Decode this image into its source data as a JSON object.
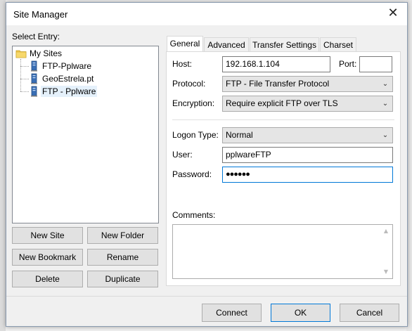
{
  "window": {
    "title": "Site Manager"
  },
  "tree": {
    "label": "Select Entry:",
    "root": "My Sites",
    "sites": [
      "FTP-Pplware",
      "GeoEstrela.pt",
      "FTP - Pplware"
    ],
    "selected_index": 2
  },
  "left_buttons": {
    "new_site": "New Site",
    "new_folder": "New Folder",
    "new_bookmark": "New Bookmark",
    "rename": "Rename",
    "delete": "Delete",
    "duplicate": "Duplicate"
  },
  "tabs": [
    "General",
    "Advanced",
    "Transfer Settings",
    "Charset"
  ],
  "active_tab": "General",
  "general": {
    "host_label": "Host:",
    "host_value": "192.168.1.104",
    "port_label": "Port:",
    "port_value": "",
    "protocol_label": "Protocol:",
    "protocol_value": "FTP - File Transfer Protocol",
    "encryption_label": "Encryption:",
    "encryption_value": "Require explicit FTP over TLS",
    "logon_label": "Logon Type:",
    "logon_value": "Normal",
    "user_label": "User:",
    "user_value": "pplwareFTP",
    "password_label": "Password:",
    "password_value": "●●●●●●",
    "comments_label": "Comments:"
  },
  "footer": {
    "connect": "Connect",
    "ok": "OK",
    "cancel": "Cancel"
  },
  "colors": {
    "selection": "#e5f1fb",
    "focus_border": "#0078d7",
    "button_bg": "#e1e1e1"
  }
}
